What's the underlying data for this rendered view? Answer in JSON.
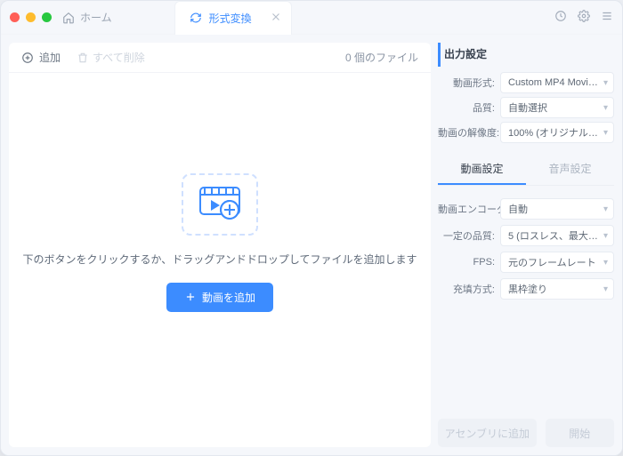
{
  "titlebar": {
    "home_label": "ホーム",
    "tab_label": "形式変換"
  },
  "toolbar": {
    "add_label": "追加",
    "delete_all_label": "すべて削除",
    "file_count_label": "0 個のファイル"
  },
  "dropzone": {
    "hint": "下のボタンをクリックするか、ドラッグアンドドロップしてファイルを追加します",
    "add_button": "動画を追加"
  },
  "output": {
    "title": "出力設定",
    "video_format_label": "動画形式:",
    "video_format_value": "Custom MP4 Movie(...",
    "quality_label": "品質:",
    "quality_value": "自動選択",
    "resolution_label": "動画の解像度:",
    "resolution_value": "100% (オリジナルア..."
  },
  "subtabs": {
    "video": "動画設定",
    "audio": "音声設定"
  },
  "video_settings": {
    "encoder_label": "動画エンコーダ:",
    "encoder_value": "自動",
    "const_quality_label": "一定の品質:",
    "const_quality_value": "5 (ロスレス、最大サ...",
    "fps_label": "FPS:",
    "fps_value": "元のフレームレート",
    "fill_label": "充填方式:",
    "fill_value": "黒枠塗り"
  },
  "footer": {
    "add_to_assembly": "アセンブリに追加",
    "start": "開始"
  }
}
